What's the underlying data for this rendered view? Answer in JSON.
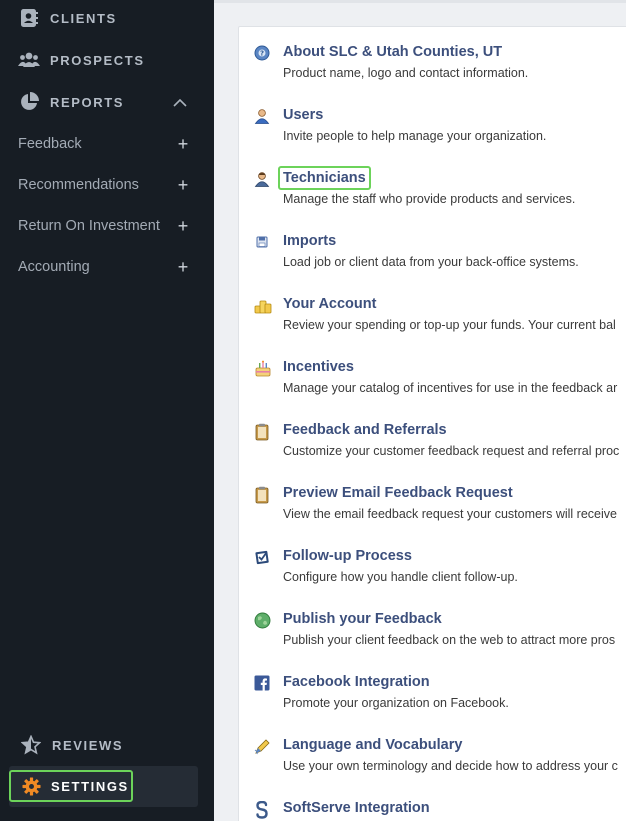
{
  "sidebar": {
    "main": [
      {
        "label": "CLIENTS",
        "icon": "address-book-icon"
      },
      {
        "label": "PROSPECTS",
        "icon": "users-icon"
      },
      {
        "label": "REPORTS",
        "icon": "pie-chart-icon",
        "expanded": true
      }
    ],
    "subitems": [
      {
        "label": "Feedback",
        "action": "+"
      },
      {
        "label": "Recommendations",
        "action": "+"
      },
      {
        "label": "Return On Investment",
        "action": "+"
      },
      {
        "label": "Accounting",
        "action": "+"
      }
    ],
    "reviews": {
      "label": "REVIEWS",
      "icon": "star-icon"
    },
    "settings": {
      "label": "SETTINGS",
      "icon": "gear-icon",
      "active": true
    }
  },
  "settings_list": [
    {
      "title": "About SLC & Utah Counties, UT",
      "desc": "Product name, logo and contact information.",
      "icon": "info-globe-icon"
    },
    {
      "title": "Users",
      "desc": "Invite people to help manage your organization.",
      "icon": "user-icon"
    },
    {
      "title": "Technicians",
      "desc": "Manage the staff who provide products and services.",
      "icon": "technician-icon",
      "highlighted": true
    },
    {
      "title": "Imports",
      "desc": "Load job or client data from your back-office systems.",
      "icon": "floppy-disk-icon"
    },
    {
      "title": "Your Account",
      "desc": "Review your spending or top-up your funds. Your current bal",
      "icon": "coins-icon"
    },
    {
      "title": "Incentives",
      "desc": "Manage your catalog of incentives for use in the feedback ar",
      "icon": "cake-icon"
    },
    {
      "title": "Feedback and Referrals",
      "desc": "Customize your customer feedback request and referral proc",
      "icon": "clipboard-icon"
    },
    {
      "title": "Preview Email Feedback Request",
      "desc": "View the email feedback request your customers will receive",
      "icon": "clipboard-icon"
    },
    {
      "title": "Follow-up Process",
      "desc": "Configure how you handle client follow-up.",
      "icon": "checkbox-icon"
    },
    {
      "title": "Publish your Feedback",
      "desc": "Publish your client feedback on the web to attract more pros",
      "icon": "globe-icon"
    },
    {
      "title": "Facebook Integration",
      "desc": "Promote your organization on Facebook.",
      "icon": "facebook-icon"
    },
    {
      "title": "Language and Vocabulary",
      "desc": "Use your own terminology and decide how to address your c",
      "icon": "pen-icon"
    },
    {
      "title": "SoftServe Integration",
      "desc": "",
      "icon": "softserve-icon"
    }
  ],
  "colors": {
    "sidebar_bg": "#171d24",
    "accent_orange": "#f08a24",
    "highlight_green": "#6cd35a",
    "link_blue": "#3c4f7c"
  }
}
